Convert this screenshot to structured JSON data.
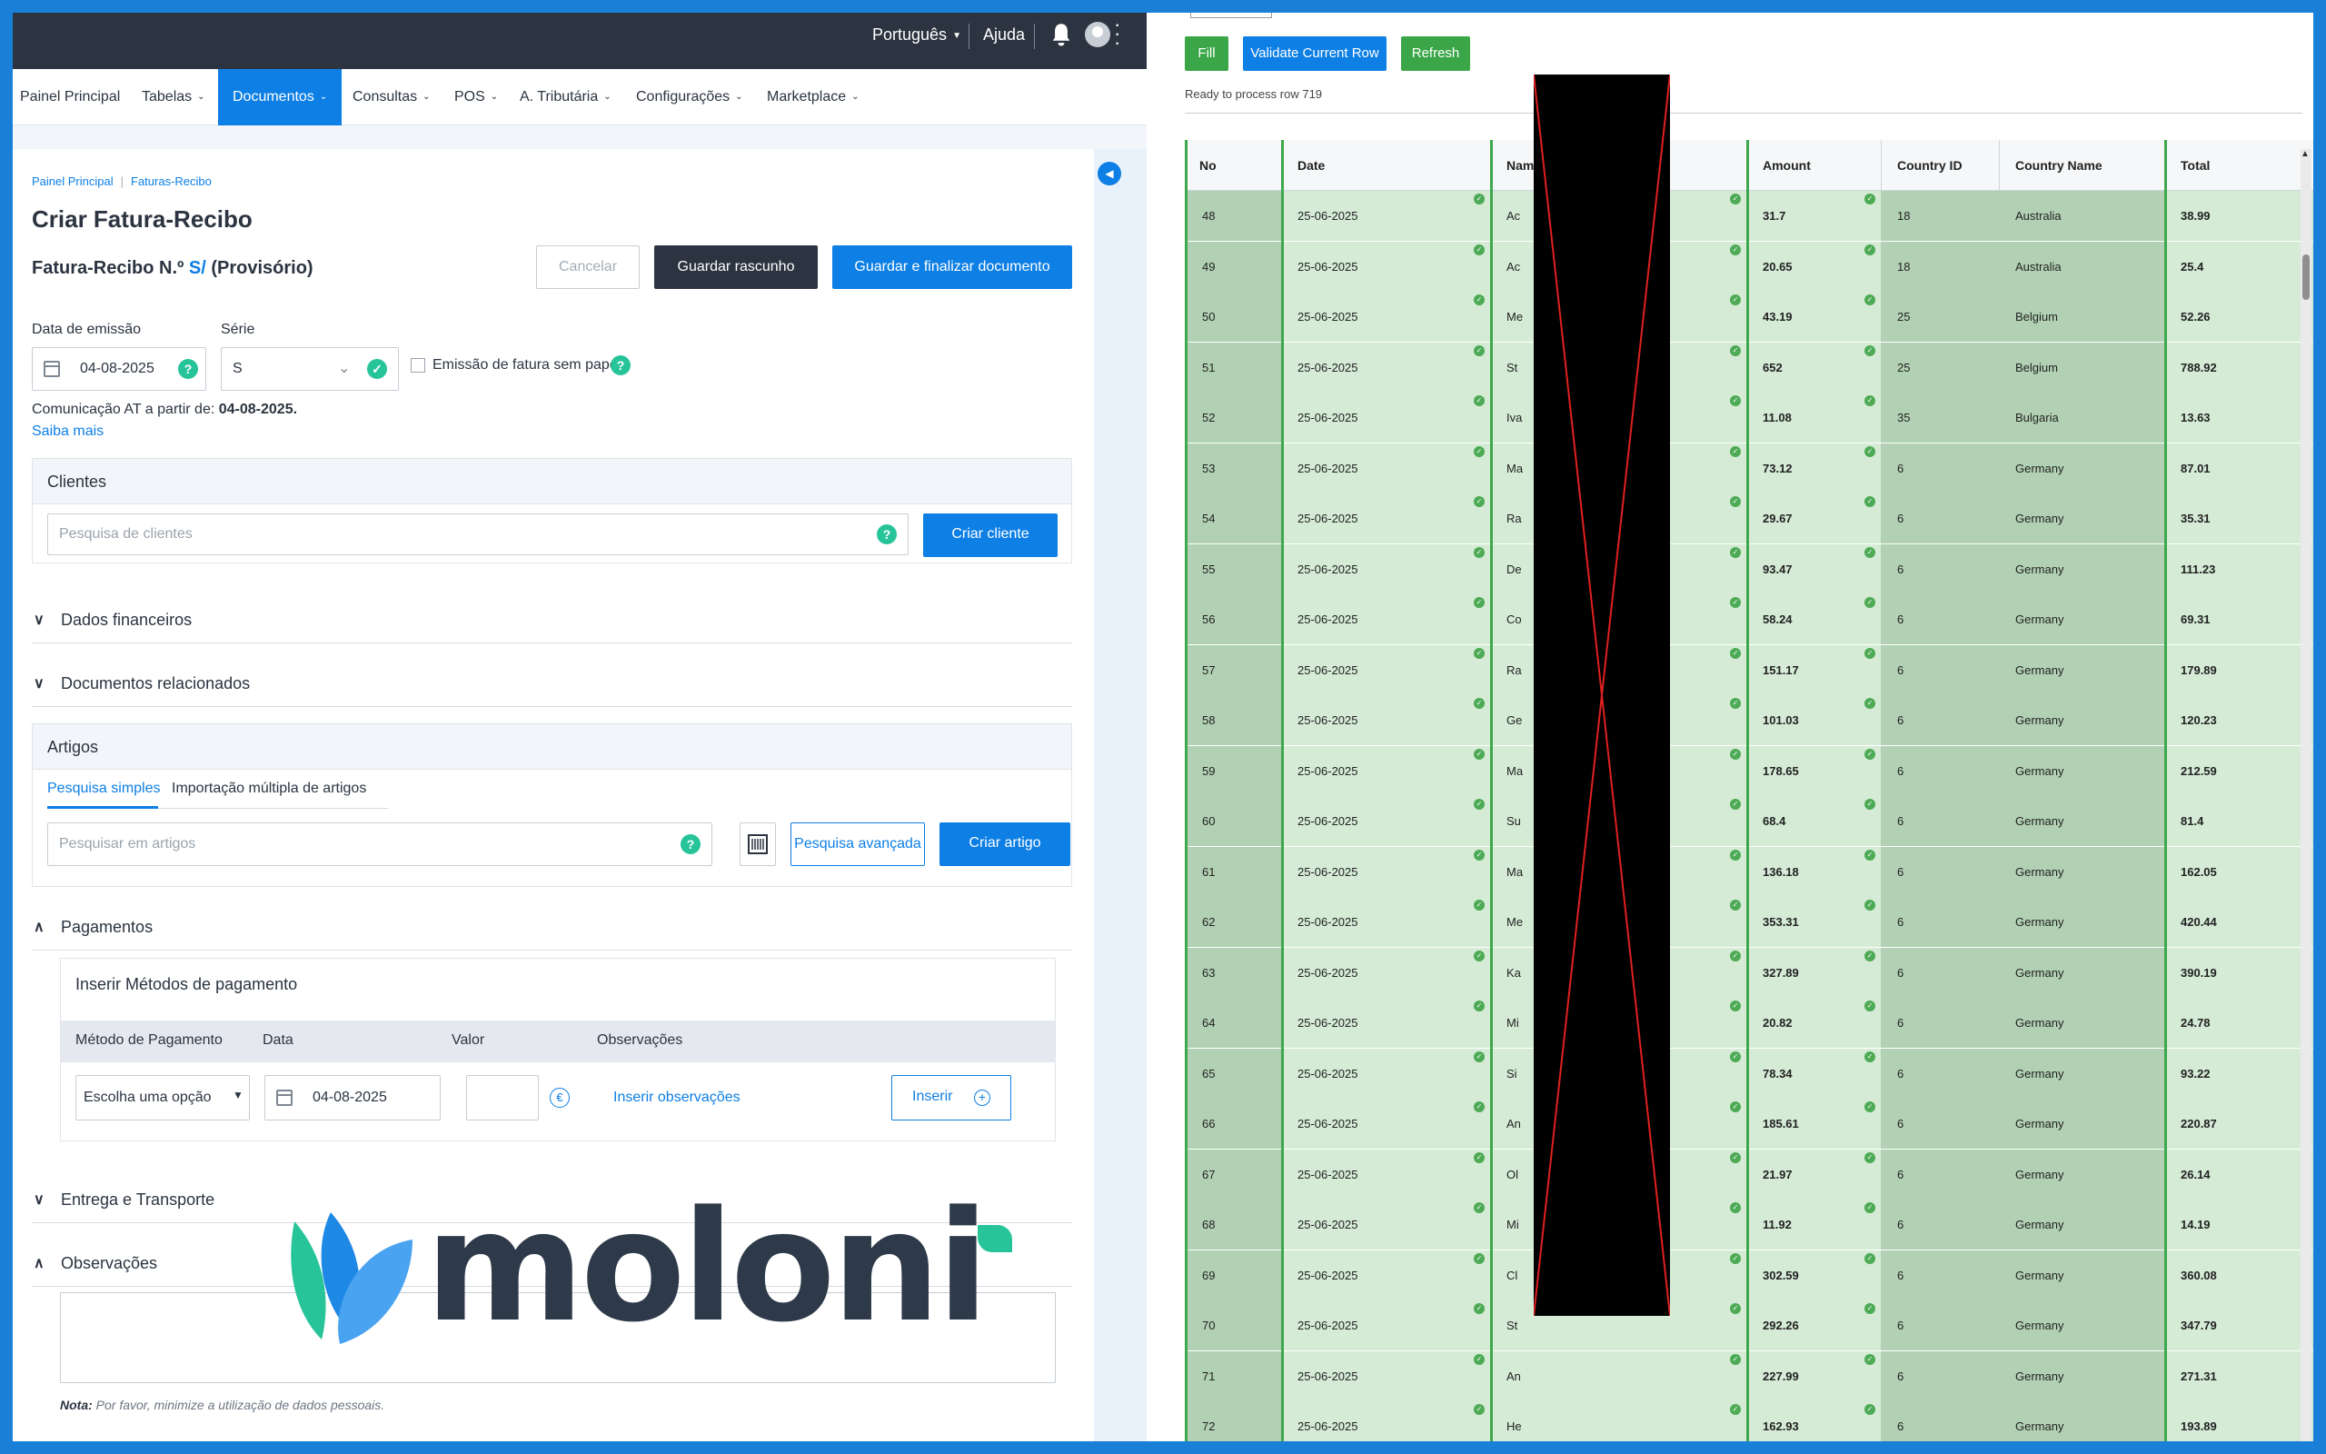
{
  "topbar": {
    "language": "Português",
    "help": "Ajuda"
  },
  "nav": [
    {
      "label": "Painel Principal",
      "dropdown": false,
      "active": false
    },
    {
      "label": "Tabelas",
      "dropdown": true,
      "active": false
    },
    {
      "label": "Documentos",
      "dropdown": true,
      "active": true
    },
    {
      "label": "Consultas",
      "dropdown": true,
      "active": false
    },
    {
      "label": "POS",
      "dropdown": true,
      "active": false
    },
    {
      "label": "A. Tributária",
      "dropdown": true,
      "active": false
    },
    {
      "label": "Configurações",
      "dropdown": true,
      "active": false
    },
    {
      "label": "Marketplace",
      "dropdown": true,
      "active": false
    }
  ],
  "breadcrumb": [
    "Painel Principal",
    "Faturas-Recibo"
  ],
  "page_title": "Criar Fatura-Recibo",
  "doc": {
    "prefix": "Fatura-Recibo N.º",
    "number": "S/",
    "status": "(Provisório)"
  },
  "actions": {
    "cancel": "Cancelar",
    "draft": "Guardar rascunho",
    "finalize": "Guardar e finalizar documento"
  },
  "form": {
    "date_label": "Data de emissão",
    "date_value": "04-08-2025",
    "series_label": "Série",
    "series_value": "S",
    "paperless_label": "Emissão de fatura sem papel",
    "at_text": "Comunicação AT a partir de:",
    "at_date": "04-08-2025.",
    "learn_more": "Saiba mais"
  },
  "clients": {
    "title": "Clientes",
    "search_placeholder": "Pesquisa de clientes",
    "create": "Criar cliente"
  },
  "sections": {
    "financial": "Dados financeiros",
    "related": "Documentos relacionados",
    "payments": "Pagamentos",
    "delivery": "Entrega e Transporte",
    "observations": "Observações"
  },
  "articles": {
    "title": "Artigos",
    "tab_simple": "Pesquisa simples",
    "tab_import": "Importação múltipla de artigos",
    "search_placeholder": "Pesquisar em artigos",
    "advanced": "Pesquisa avançada",
    "create": "Criar artigo"
  },
  "payment": {
    "title": "Inserir Métodos de pagamento",
    "columns": [
      "Método de Pagamento",
      "Data",
      "Valor",
      "Observações"
    ],
    "method_placeholder": "Escolha uma opção",
    "date_value": "04-08-2025",
    "currency": "€",
    "insert_obs": "Inserir observações",
    "insert": "Inserir"
  },
  "note": {
    "label": "Nota:",
    "text": "Por favor, minimize a utilização de dados pessoais."
  },
  "watermark": {
    "brand": "moloni"
  },
  "tool": {
    "buttons": {
      "fill": "Fill",
      "validate": "Validate Current Row",
      "refresh": "Refresh"
    },
    "status": "Ready to process row 719",
    "columns": [
      "No",
      "Date",
      "Name",
      "Amount",
      "Country ID",
      "Country Name",
      "Total"
    ],
    "rows": [
      {
        "no": "48",
        "date": "25-06-2025",
        "name": "Ac",
        "amount": "31.7",
        "cid": "18",
        "cname": "Australia",
        "total": "38.99"
      },
      {
        "no": "49",
        "date": "25-06-2025",
        "name": "Ac",
        "amount": "20.65",
        "cid": "18",
        "cname": "Australia",
        "total": "25.4"
      },
      {
        "no": "50",
        "date": "25-06-2025",
        "name": "Me",
        "amount": "43.19",
        "cid": "25",
        "cname": "Belgium",
        "total": "52.26"
      },
      {
        "no": "51",
        "date": "25-06-2025",
        "name": "St",
        "amount": "652",
        "cid": "25",
        "cname": "Belgium",
        "total": "788.92"
      },
      {
        "no": "52",
        "date": "25-06-2025",
        "name": "Iva",
        "amount": "11.08",
        "cid": "35",
        "cname": "Bulgaria",
        "total": "13.63"
      },
      {
        "no": "53",
        "date": "25-06-2025",
        "name": "Ma",
        "amount": "73.12",
        "cid": "6",
        "cname": "Germany",
        "total": "87.01"
      },
      {
        "no": "54",
        "date": "25-06-2025",
        "name": "Ra",
        "amount": "29.67",
        "cid": "6",
        "cname": "Germany",
        "total": "35.31"
      },
      {
        "no": "55",
        "date": "25-06-2025",
        "name": "De",
        "amount": "93.47",
        "cid": "6",
        "cname": "Germany",
        "total": "111.23"
      },
      {
        "no": "56",
        "date": "25-06-2025",
        "name": "Co",
        "amount": "58.24",
        "cid": "6",
        "cname": "Germany",
        "total": "69.31"
      },
      {
        "no": "57",
        "date": "25-06-2025",
        "name": "Ra",
        "amount": "151.17",
        "cid": "6",
        "cname": "Germany",
        "total": "179.89"
      },
      {
        "no": "58",
        "date": "25-06-2025",
        "name": "Ge",
        "amount": "101.03",
        "cid": "6",
        "cname": "Germany",
        "total": "120.23"
      },
      {
        "no": "59",
        "date": "25-06-2025",
        "name": "Ma",
        "amount": "178.65",
        "cid": "6",
        "cname": "Germany",
        "total": "212.59"
      },
      {
        "no": "60",
        "date": "25-06-2025",
        "name": "Su",
        "amount": "68.4",
        "cid": "6",
        "cname": "Germany",
        "total": "81.4"
      },
      {
        "no": "61",
        "date": "25-06-2025",
        "name": "Ma",
        "amount": "136.18",
        "cid": "6",
        "cname": "Germany",
        "total": "162.05"
      },
      {
        "no": "62",
        "date": "25-06-2025",
        "name": "Me",
        "amount": "353.31",
        "cid": "6",
        "cname": "Germany",
        "total": "420.44"
      },
      {
        "no": "63",
        "date": "25-06-2025",
        "name": "Ka",
        "amount": "327.89",
        "cid": "6",
        "cname": "Germany",
        "total": "390.19"
      },
      {
        "no": "64",
        "date": "25-06-2025",
        "name": "Mi",
        "amount": "20.82",
        "cid": "6",
        "cname": "Germany",
        "total": "24.78"
      },
      {
        "no": "65",
        "date": "25-06-2025",
        "name": "Si",
        "amount": "78.34",
        "cid": "6",
        "cname": "Germany",
        "total": "93.22"
      },
      {
        "no": "66",
        "date": "25-06-2025",
        "name": "An",
        "amount": "185.61",
        "cid": "6",
        "cname": "Germany",
        "total": "220.87"
      },
      {
        "no": "67",
        "date": "25-06-2025",
        "name": "Ol",
        "amount": "21.97",
        "cid": "6",
        "cname": "Germany",
        "total": "26.14"
      },
      {
        "no": "68",
        "date": "25-06-2025",
        "name": "Mi",
        "amount": "11.92",
        "cid": "6",
        "cname": "Germany",
        "total": "14.19"
      },
      {
        "no": "69",
        "date": "25-06-2025",
        "name": "Cl",
        "amount": "302.59",
        "cid": "6",
        "cname": "Germany",
        "total": "360.08"
      },
      {
        "no": "70",
        "date": "25-06-2025",
        "name": "St",
        "amount": "292.26",
        "cid": "6",
        "cname": "Germany",
        "total": "347.79"
      },
      {
        "no": "71",
        "date": "25-06-2025",
        "name": "An",
        "amount": "227.99",
        "cid": "6",
        "cname": "Germany",
        "total": "271.31"
      },
      {
        "no": "72",
        "date": "25-06-2025",
        "name": "He",
        "amount": "162.93",
        "cid": "6",
        "cname": "Germany",
        "total": "193.89"
      }
    ]
  },
  "colors": {
    "accent": "#0d7fe5",
    "dark": "#2b3440",
    "success": "#27c49a",
    "grid_green": "#3fa84c",
    "button_green": "#3aa648",
    "frame": "#1a7fd6"
  }
}
